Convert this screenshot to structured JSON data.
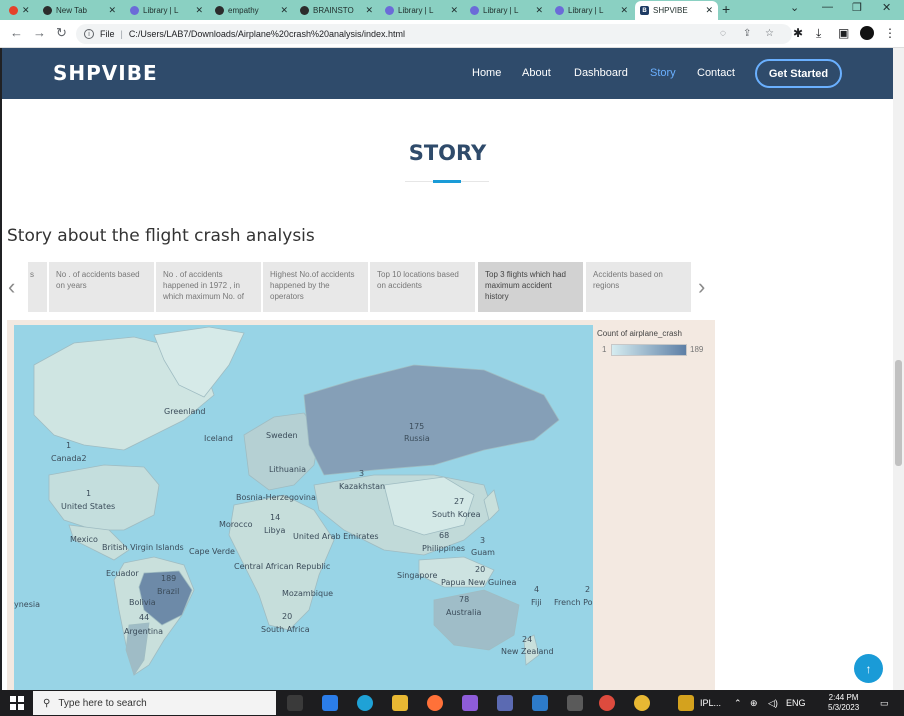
{
  "browser": {
    "tabs": [
      {
        "label": "",
        "icon": "gmail-icon"
      },
      {
        "label": "New Tab",
        "icon": "chrome-icon"
      },
      {
        "label": "Library | L",
        "icon": "library-icon"
      },
      {
        "label": "empathy",
        "icon": "web-icon"
      },
      {
        "label": "BRAINSTO",
        "icon": "web-icon"
      },
      {
        "label": "Library | L",
        "icon": "library-icon"
      },
      {
        "label": "Library | L",
        "icon": "library-icon"
      },
      {
        "label": "Library | L",
        "icon": "library-icon"
      },
      {
        "label": "SHPVIBE",
        "icon": "bootstrap-icon"
      }
    ],
    "address_scheme": "File",
    "url": "C:/Users/LAB7/Downloads/Airplane%20crash%20analysis/index.html"
  },
  "site": {
    "logo": "SHPVIBE",
    "nav": [
      "Home",
      "About",
      "Dashboard",
      "Story",
      "Contact"
    ],
    "active_nav": "Story",
    "cta_label": "Get Started",
    "accent_color": "#1a9bd7",
    "header_color": "#2f4b6b"
  },
  "section": {
    "title": "STORY",
    "story_heading": "Story about the flight crash analysis"
  },
  "story_points": [
    {
      "label": "s",
      "active": false
    },
    {
      "label": "No . of accidents based on years",
      "active": false
    },
    {
      "label": "No . of accidents happened in 1972 , in which maximum No. of",
      "active": false
    },
    {
      "label": "Highest No.of accidents happened by the operators",
      "active": false
    },
    {
      "label": "Top 10 locations based on accidents",
      "active": false
    },
    {
      "label": "Top 3 flights which had maximum accident history",
      "active": true
    },
    {
      "label": "Accidents based on regions",
      "active": false
    }
  ],
  "legend": {
    "title": "Count of airplane_crash",
    "min": "1",
    "max": "189"
  },
  "map_labels": [
    {
      "text": "Greenland"
    },
    {
      "text": "Iceland"
    },
    {
      "text": "Sweden"
    },
    {
      "text": "175"
    },
    {
      "text": "Russia"
    },
    {
      "text": "1"
    },
    {
      "text": "Canada2"
    },
    {
      "text": "Lithuania"
    },
    {
      "text": "3"
    },
    {
      "text": "Kazakhstan"
    },
    {
      "text": "1"
    },
    {
      "text": "United States"
    },
    {
      "text": "Bosnia-Herzegovina"
    },
    {
      "text": "27"
    },
    {
      "text": "South Korea"
    },
    {
      "text": "Morocco"
    },
    {
      "text": "14"
    },
    {
      "text": "Libya"
    },
    {
      "text": "United Arab Emirates"
    },
    {
      "text": "68"
    },
    {
      "text": "Philippines"
    },
    {
      "text": "3"
    },
    {
      "text": "Guam"
    },
    {
      "text": "Mexico"
    },
    {
      "text": "British Virgin Islands"
    },
    {
      "text": "Cape Verde"
    },
    {
      "text": "Central African Republic"
    },
    {
      "text": "20"
    },
    {
      "text": "Singapore"
    },
    {
      "text": "Papua New Guinea"
    },
    {
      "text": "Ecuador"
    },
    {
      "text": "189"
    },
    {
      "text": "Brazil"
    },
    {
      "text": "Mozambique"
    },
    {
      "text": "78"
    },
    {
      "text": "Australia"
    },
    {
      "text": "4"
    },
    {
      "text": "Fiji"
    },
    {
      "text": "2"
    },
    {
      "text": "French Pol"
    },
    {
      "text": "Bolivia"
    },
    {
      "text": "44"
    },
    {
      "text": "Argentina"
    },
    {
      "text": "20"
    },
    {
      "text": "South Africa"
    },
    {
      "text": "24"
    },
    {
      "text": "New Zealand"
    },
    {
      "text": "ynesia"
    }
  ],
  "taskbar": {
    "search_placeholder": "Type here to search",
    "app_label": "IPL...",
    "language": "ENG",
    "time": "2:44 PM",
    "date": "5/3/2023"
  }
}
